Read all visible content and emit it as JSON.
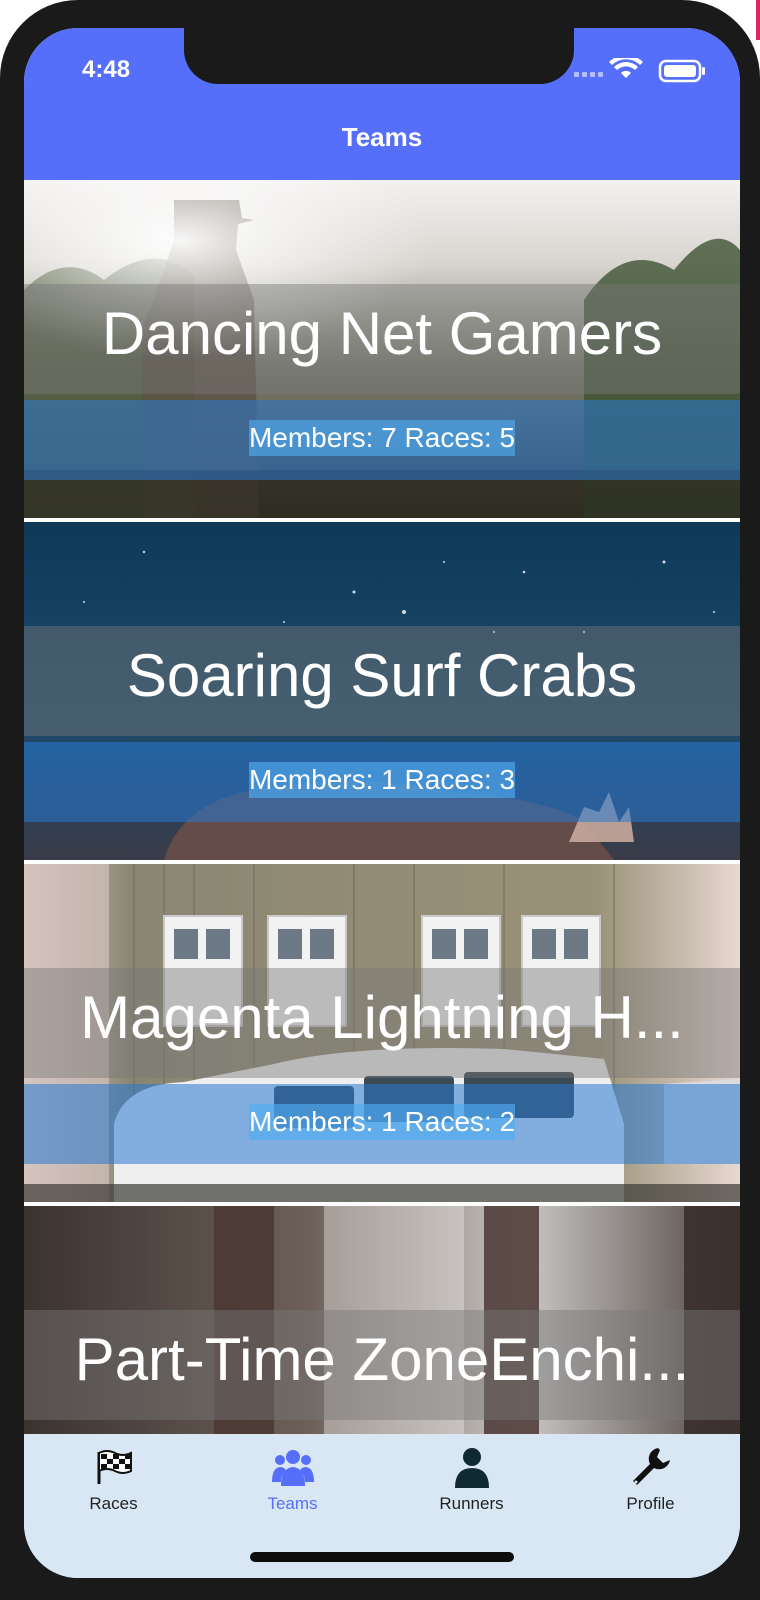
{
  "status_bar": {
    "time": "4:48"
  },
  "nav": {
    "title": "Teams",
    "bar_color": "#556ffa"
  },
  "teams": [
    {
      "name": "Dancing Net Gamers",
      "stats": "Members: 7 Races: 5"
    },
    {
      "name": "Soaring Surf Crabs",
      "stats": "Members: 1 Races: 3"
    },
    {
      "name": "Magenta Lightning H...",
      "stats": "Members: 1 Races: 2"
    },
    {
      "name": "Part-Time ZoneEnchi..."
    }
  ],
  "tabbar": {
    "active_color": "#556ffa",
    "tabs": [
      {
        "label": "Races",
        "icon": "checkered-flag-icon"
      },
      {
        "label": "Teams",
        "icon": "group-icon",
        "active": true
      },
      {
        "label": "Runners",
        "icon": "person-icon"
      },
      {
        "label": "Profile",
        "icon": "wrench-icon"
      }
    ]
  }
}
